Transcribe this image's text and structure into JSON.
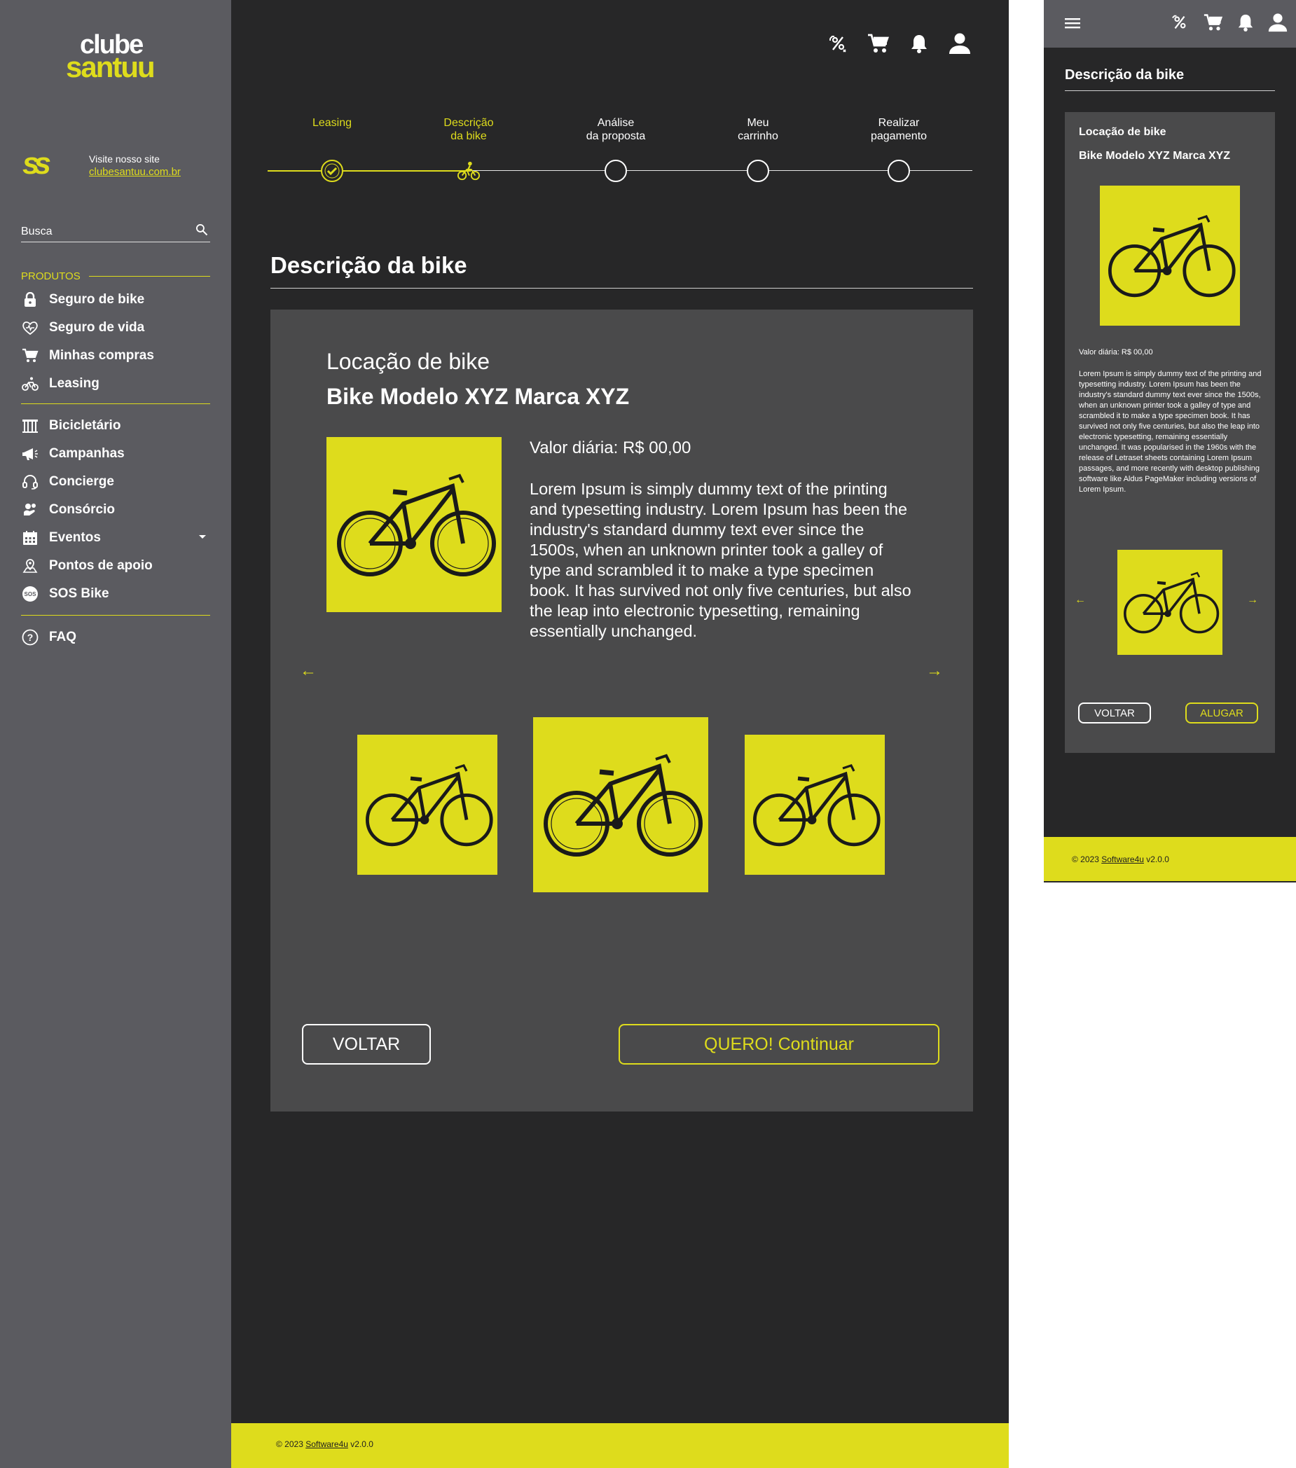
{
  "brand": {
    "logo_top": "clube",
    "logo_bottom": "santuu",
    "mark": "ss",
    "colors": {
      "accent": "#dedc1c",
      "background": "#272728",
      "panel": "#4a4a4b",
      "sidebar": "#5b5b60"
    }
  },
  "sidebar": {
    "visit_label": "Visite nosso site",
    "visit_link": "clubesantuu.com.br",
    "search_placeholder": "Busca",
    "section_label": "PRODUTOS",
    "group1": [
      {
        "label": "Seguro de bike",
        "icon": "lock-icon"
      },
      {
        "label": "Seguro de vida",
        "icon": "heart-icon"
      },
      {
        "label": "Minhas compras",
        "icon": "cart-icon"
      },
      {
        "label": "Leasing",
        "icon": "bike-icon"
      }
    ],
    "group2": [
      {
        "label": "Bicicletário",
        "icon": "bike-rack-icon"
      },
      {
        "label": "Campanhas",
        "icon": "megaphone-icon"
      },
      {
        "label": "Concierge",
        "icon": "headset-icon"
      },
      {
        "label": "Consórcio",
        "icon": "coins-icon"
      },
      {
        "label": "Eventos",
        "icon": "calendar-icon"
      },
      {
        "label": "Pontos de apoio",
        "icon": "map-pin-icon"
      },
      {
        "label": "SOS Bike",
        "icon": "sos-icon"
      }
    ],
    "group3": [
      {
        "label": "FAQ",
        "icon": "help-icon"
      }
    ]
  },
  "header": {
    "icons": [
      "discount-icon",
      "cart-icon",
      "bell-icon",
      "user-icon"
    ]
  },
  "stepper": {
    "steps": [
      {
        "label": "Leasing",
        "state": "done"
      },
      {
        "label": "Descrição\nda bike",
        "state": "current"
      },
      {
        "label": "Análise\nda proposta",
        "state": "pending"
      },
      {
        "label": "Meu\ncarrinho",
        "state": "pending"
      },
      {
        "label": "Realizar\npagamento",
        "state": "pending"
      }
    ]
  },
  "main": {
    "page_title": "Descrição da bike",
    "card_title": "Locação de bike",
    "card_subtitle": "Bike Modelo XYZ Marca XYZ",
    "price": "Valor diária: R$ 00,00",
    "description": "Lorem Ipsum is simply dummy text of the printing and typesetting industry. Lorem Ipsum has been the industry's standard dummy text ever since the 1500s, when an unknown printer took a galley of type and scrambled it to make a type specimen book. It has survived not only five centuries, but also the leap into electronic typesetting, remaining essentially unchanged.",
    "back_button": "VOLTAR",
    "continue_button": "QUERO! Continuar"
  },
  "footer": {
    "prefix": "© 2023",
    "link": "Software4u",
    "version": "v2.0.0"
  },
  "mobile": {
    "page_title": "Descrição da bike",
    "card_title": "Locação de bike",
    "card_subtitle": "Bike Modelo XYZ Marca XYZ",
    "price": "Valor diária: R$ 00,00",
    "description": "Lorem Ipsum is simply dummy text of the printing and typesetting industry. Lorem Ipsum has been the industry's standard dummy text ever since the 1500s, when an unknown printer took a galley of type and scrambled it to make a type specimen book. It has survived not only five centuries, but also the leap into electronic typesetting, remaining essentially unchanged. It was popularised in the 1960s with the release of Letraset sheets containing Lorem Ipsum passages, and more recently with desktop publishing software like Aldus PageMaker including versions of Lorem Ipsum.",
    "back_button": "VOLTAR",
    "rent_button": "ALUGAR"
  }
}
